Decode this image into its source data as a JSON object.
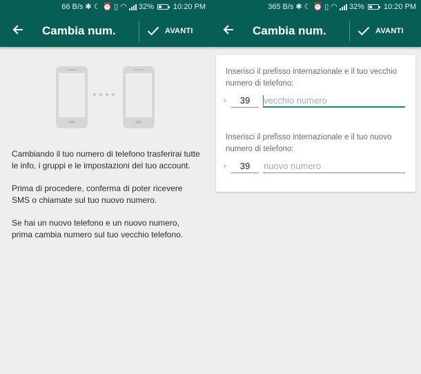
{
  "colors": {
    "primary": "#075e54",
    "accent": "#0f8a7e",
    "background": "#eeeeee"
  },
  "status_left": {
    "speed": "66 B/s",
    "battery": "32%",
    "battery_level": 0.32,
    "time": "10:20 PM"
  },
  "status_right": {
    "speed": "365 B/s",
    "battery": "32%",
    "battery_level": 0.32,
    "time": "10:20 PM"
  },
  "toolbar": {
    "title": "Cambia num.",
    "next_label": "AVANTI",
    "back_icon": "arrow-left-icon",
    "next_icon": "check-icon"
  },
  "left": {
    "paragraphs": [
      "Cambiando il tuo numero di telefono trasferirai tutte le info, i gruppi e le impostazioni del tuo account.",
      "Prima di procedere, conferma di poter ricevere SMS o chiamate sul tuo nuovo numero.",
      "Se hai un nuovo telefono e un nuovo numero, prima cambia numero sul tuo vecchio telefono."
    ]
  },
  "right": {
    "old": {
      "label": "Inserisci il prefisso internazionale e il tuo vecchio numero di telefono:",
      "plus": "+",
      "country_code": "39",
      "placeholder": "vecchio numero"
    },
    "new": {
      "label": "Inserisci il prefisso internazionale e il tuo nuovo numero di telefono:",
      "plus": "+",
      "country_code": "39",
      "placeholder": "nuovo numero"
    }
  }
}
